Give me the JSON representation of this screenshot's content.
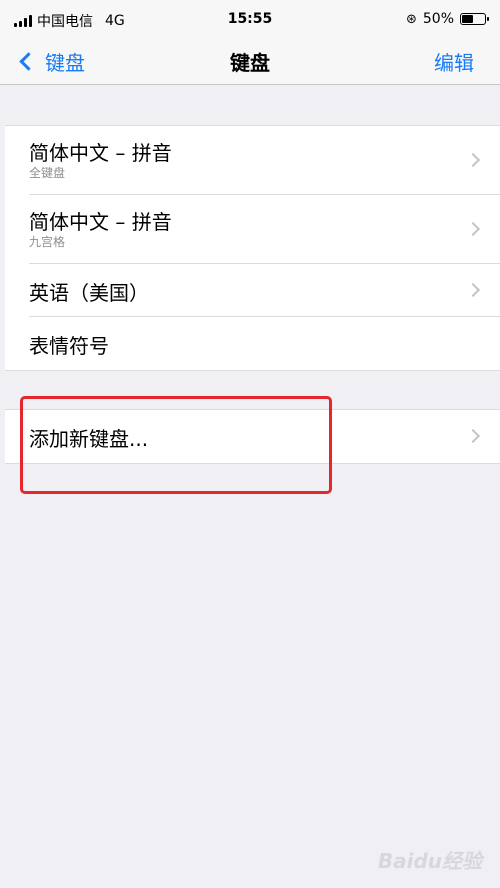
{
  "status_bar": {
    "carrier": "中国电信",
    "network": "4G",
    "time": "15:55",
    "battery_percent": "50%",
    "battery_level": 0.5
  },
  "nav": {
    "back_label": "键盘",
    "title": "键盘",
    "edit_label": "编辑"
  },
  "keyboards": [
    {
      "title": "简体中文 – 拼音",
      "subtitle": "全键盘"
    },
    {
      "title": "简体中文 – 拼音",
      "subtitle": "九宫格"
    },
    {
      "title": "英语（美国）"
    },
    {
      "title": "表情符号"
    }
  ],
  "add_keyboard": {
    "label": "添加新键盘..."
  },
  "watermark": "Baidu经验",
  "colors": {
    "accent": "#1a7cf5",
    "highlight": "#e5262c",
    "background": "#efeff4"
  }
}
